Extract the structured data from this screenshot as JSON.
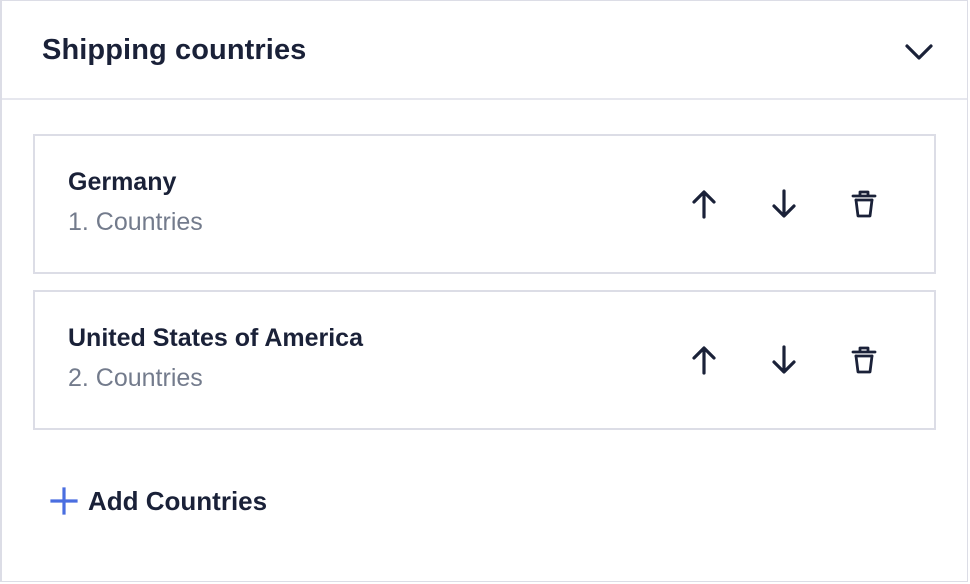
{
  "panel": {
    "title": "Shipping countries",
    "collapse_icon": "chevron-down-icon"
  },
  "items": [
    {
      "name": "Germany",
      "subtitle": "1. Countries",
      "actions": [
        "arrow-up-icon",
        "arrow-down-icon",
        "trash-icon"
      ]
    },
    {
      "name": "United States of America",
      "subtitle": "2. Countries",
      "actions": [
        "arrow-up-icon",
        "arrow-down-icon",
        "trash-icon"
      ]
    }
  ],
  "add_button": {
    "label": "Add Countries",
    "icon": "plus-icon",
    "icon_color": "#4a6ee0"
  },
  "colors": {
    "text_primary": "#1a2138",
    "text_secondary": "#737b8c",
    "border": "#dcdde6",
    "accent": "#4a6ee0"
  }
}
